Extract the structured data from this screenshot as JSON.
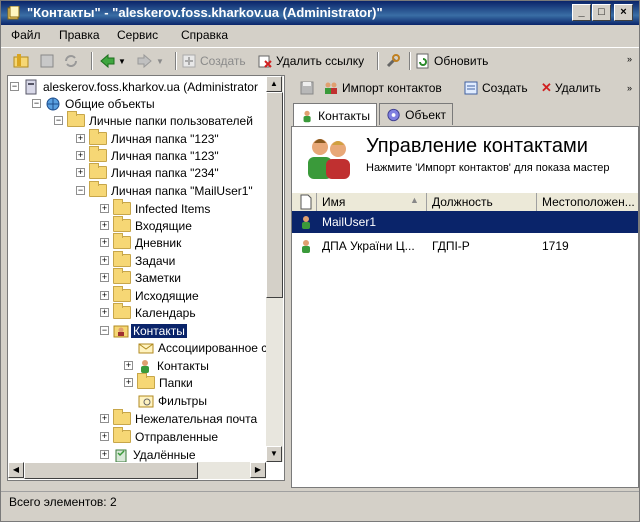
{
  "window": {
    "title": "\"Контакты\" - \"aleskerov.foss.kharkov.ua (Administrator)\""
  },
  "menu": [
    "Файл",
    "Правка",
    "Сервис",
    "Справка"
  ],
  "toolbar": {
    "create": "Создать",
    "delete_link": "Удалить ссылку",
    "refresh": "Обновить"
  },
  "tree": {
    "items": [
      {
        "label": "aleskerov.foss.kharkov.ua (Administrator"
      },
      {
        "label": "Общие объекты"
      },
      {
        "label": "Личные папки пользователей"
      },
      {
        "label": "Личная папка \"123\""
      },
      {
        "label": "Личная папка \"123\""
      },
      {
        "label": "Личная папка \"234\""
      },
      {
        "label": "Личная папка \"MailUser1\""
      },
      {
        "label": "Infected Items"
      },
      {
        "label": "Входящие"
      },
      {
        "label": "Дневник"
      },
      {
        "label": "Задачи"
      },
      {
        "label": "Заметки"
      },
      {
        "label": "Исходящие"
      },
      {
        "label": "Календарь"
      },
      {
        "label": "Контакты"
      },
      {
        "label": "Ассоциированное с"
      },
      {
        "label": "Контакты"
      },
      {
        "label": "Папки"
      },
      {
        "label": "Фильтры"
      },
      {
        "label": "Нежелательная почта"
      },
      {
        "label": "Отправленные"
      },
      {
        "label": "Удалённые"
      }
    ]
  },
  "right_toolbar": {
    "import": "Импорт контактов",
    "create": "Создать",
    "delete": "Удалить"
  },
  "tabs": [
    {
      "label": "Контакты"
    },
    {
      "label": "Объект"
    }
  ],
  "panel": {
    "title": "Управление контактами",
    "subtitle": "Нажмите 'Импорт контактов' для показа мастер",
    "columns": [
      "Имя",
      "Должность",
      "Местоположен..."
    ],
    "rows": [
      {
        "name": "MailUser1",
        "position": "",
        "location": ""
      },
      {
        "name": "ДПА України Ц...",
        "position": "ГДПІ-Р",
        "location": "1719"
      }
    ]
  },
  "status": {
    "text": "Всего элементов: 2"
  },
  "colors": {
    "selection": "#0a246a",
    "titlebar": "#0a246a",
    "folder": "#f6d775"
  }
}
